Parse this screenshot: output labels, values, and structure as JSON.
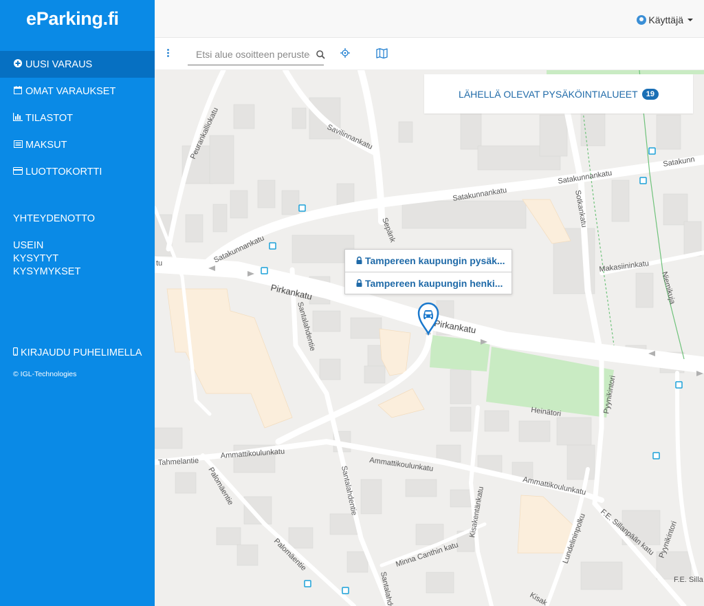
{
  "app": {
    "logo": "eParking.fi"
  },
  "sidebar": {
    "items": [
      {
        "label": "UUSI VARAUS",
        "icon": "plus-circle-icon"
      },
      {
        "label": "OMAT VARAUKSET",
        "icon": "calendar-icon"
      },
      {
        "label": "TILASTOT",
        "icon": "bar-chart-icon"
      },
      {
        "label": "MAKSUT",
        "icon": "list-icon"
      },
      {
        "label": "LUOTTOKORTTI",
        "icon": "credit-card-icon"
      }
    ],
    "contact": "YHTEYDENOTTO",
    "faq": "USEIN KYSYTYT KYSYMYKSET",
    "phone_login": "KIRJAUDU PUHELIMELLA",
    "copyright": "© IGL-Technologies"
  },
  "header": {
    "user": "Käyttäjä"
  },
  "toolbar": {
    "search_placeholder": "Etsi alue osoitteen perusteella"
  },
  "map": {
    "nearby_label": "LÄHELLÄ OLEVAT PYSÄKÖINTIALUEET",
    "nearby_count": "19",
    "popup_items": [
      "Tampereen kaupungin pysäk...",
      "Tampereen kaupungin henki..."
    ],
    "streets": {
      "satakunnankatu_1": "Satakunnankatu",
      "satakunnankatu_2": "Satakunnankatu",
      "satakunnankatu_3": "Satakunnankatu",
      "satakunnankatu_4": "Satakunnankatu",
      "pirkankatu_1": "Pirkankatu",
      "pirkankatu_2": "Pirkankatu",
      "savilinnankatu": "Savilinnankatu",
      "peurankalliontatu": "Peurankalliokatu",
      "sepankatu": "Sepänk",
      "sotkankatu": "Sotkankatu",
      "makasiininkatu": "Makasiininkatu",
      "niemikuja": "Niemikuja",
      "santalahdentie_1": "Santalahdentie",
      "santalahdentie_2": "Santalahdentie",
      "santalahdentie_3": "Santalahde",
      "heinatori": "Heinätori",
      "pyynikintori_1": "Pyynikintori",
      "pyynikintori_2": "Pyynikintori",
      "ammattikoulunkatu_1": "Ammattikoulunkatu",
      "ammattikoulunkatu_2": "Ammattikoulunkatu",
      "ammattikoulunkatu_3": "Ammattikoulunkatu",
      "tahmelantie": "Tahmelantie",
      "palomaentie_1": "Palomäentie",
      "palomaentie_2": "Palomäentie",
      "kisakentankatu": "Kisakentänkatu",
      "kisak": "Kisak",
      "minna_canthin_katu": "Minna Canthin katu",
      "lundelininpolku": "Lundelininpolku",
      "fe_sillanpaan_katu": "F.E. Sillanpään katu",
      "fe_silla": "F.E. Silla",
      "tu": "tu",
      "satakunn_right": "Satakunn"
    }
  }
}
